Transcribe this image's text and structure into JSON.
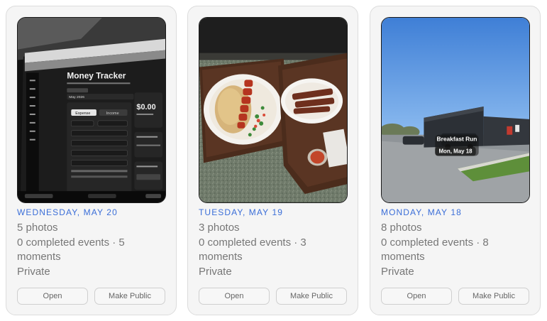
{
  "cards": [
    {
      "date": "WEDNESDAY, MAY 20",
      "photos": "5 photos",
      "events_line1": "0 completed events · 5",
      "events_line2": "moments",
      "privacy": "Private",
      "open_label": "Open",
      "public_label": "Make Public",
      "thumb": {
        "app_title": "Money Tracker",
        "balance": "$0.00",
        "tab_expense": "Expense",
        "tab_income": "Income",
        "month": "May 2026"
      }
    },
    {
      "date": "TUESDAY, MAY 19",
      "photos": "3 photos",
      "events_line1": "0 completed events · 3",
      "events_line2": "moments",
      "privacy": "Private",
      "open_label": "Open",
      "public_label": "Make Public"
    },
    {
      "date": "MONDAY, MAY 18",
      "photos": "8 photos",
      "events_line1": "0 completed events · 8",
      "events_line2": "moments",
      "privacy": "Private",
      "open_label": "Open",
      "public_label": "Make Public",
      "thumb": {
        "overlay_title": "Breakfast Run",
        "overlay_date": "Mon, May 18"
      }
    }
  ],
  "colors": {
    "date_accent": "#3b6ed8",
    "text_muted": "#777777",
    "card_bg": "#f5f5f5"
  }
}
